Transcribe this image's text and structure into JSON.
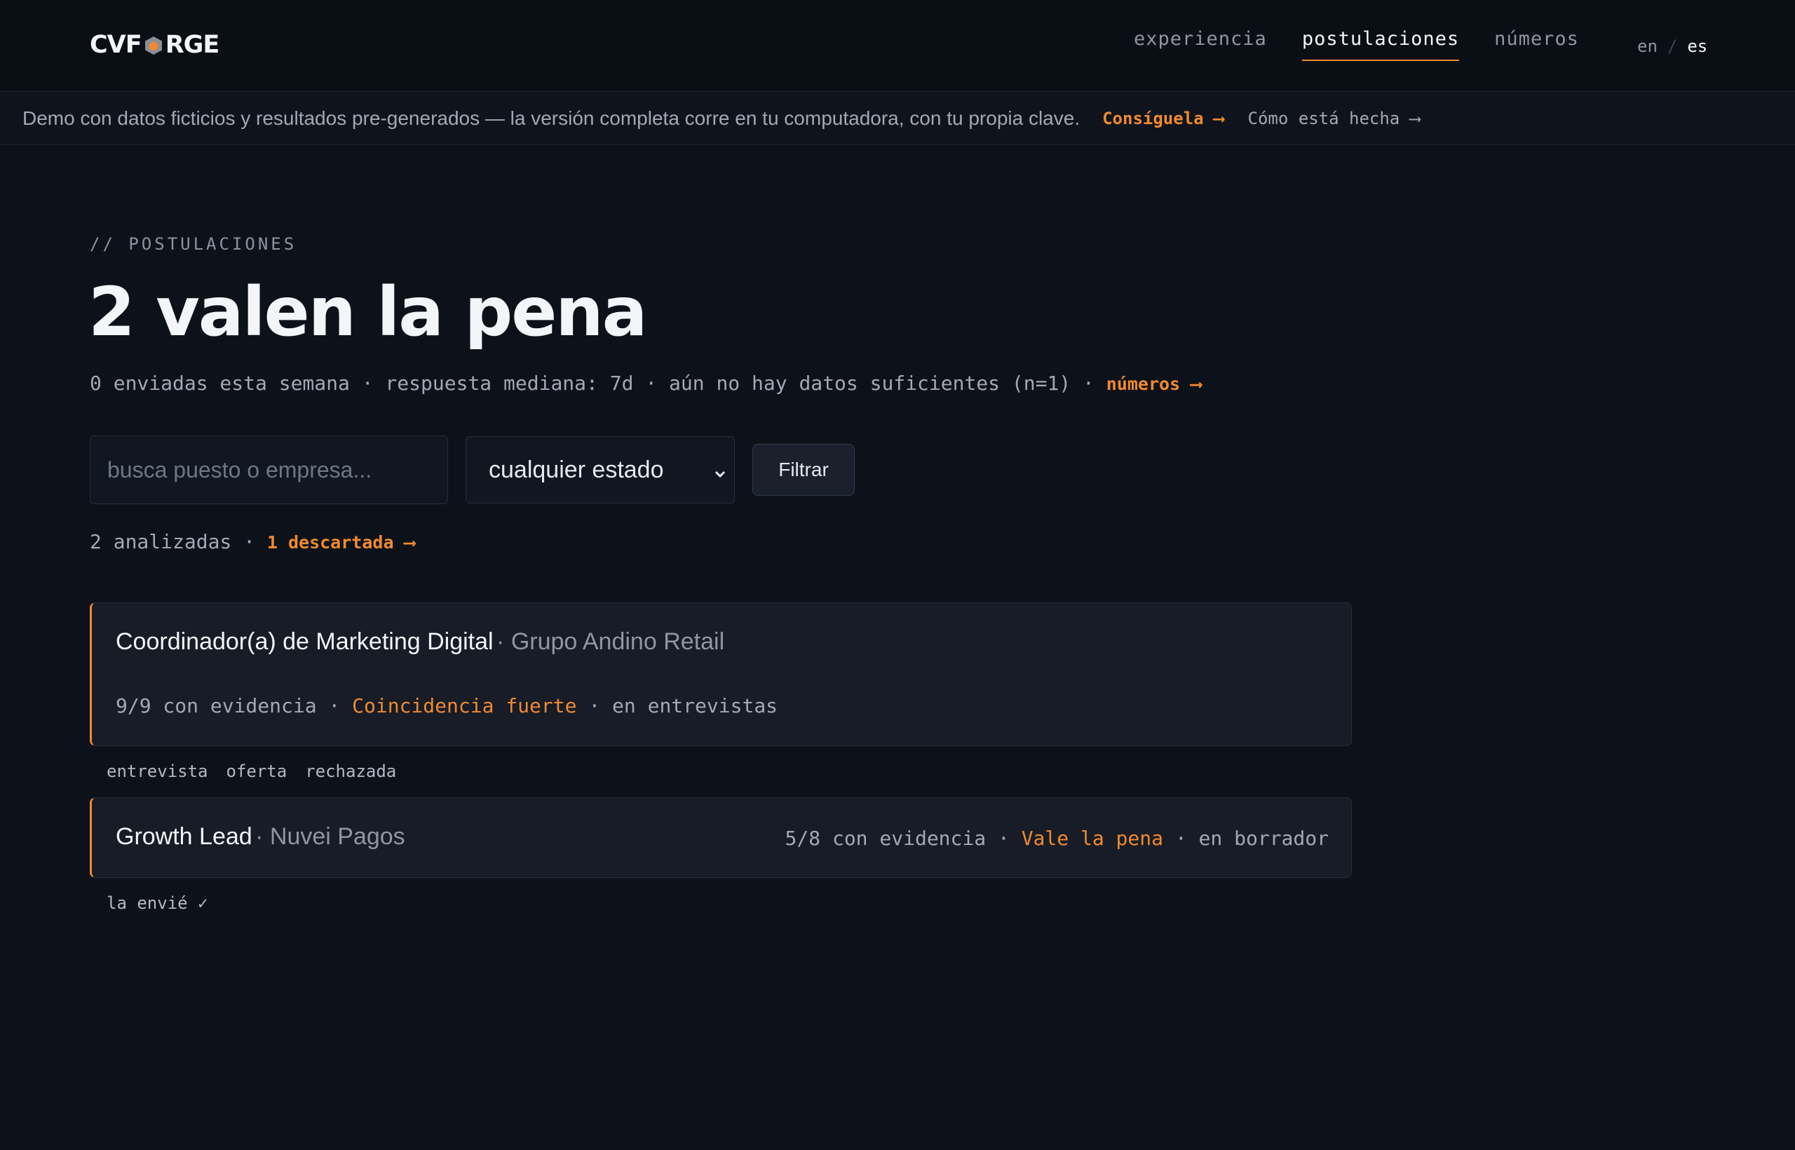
{
  "header": {
    "logo_left": "CVF",
    "logo_right": "RGE",
    "nav": [
      {
        "label": "experiencia",
        "active": false
      },
      {
        "label": "postulaciones",
        "active": true
      },
      {
        "label": "números",
        "active": false
      }
    ],
    "lang": {
      "en": "en",
      "sep": "/",
      "es": "es",
      "current": "es"
    }
  },
  "banner": {
    "message": "Demo con datos ficticios y resultados pre-generados — la versión completa corre en tu computadora, con tu propia clave.",
    "get_it": "Consíguela ⟶",
    "how_built": "Cómo está hecha ⟶"
  },
  "main": {
    "eyebrow": "// POSTULACIONES",
    "title": "2 valen la pena",
    "stats": "0 enviadas esta semana · respuesta mediana: 7d · aún no hay datos suficientes (n=1) ·",
    "stats_link": "números ⟶",
    "search_placeholder": "busca puesto o empresa...",
    "status_select": "cualquier estado",
    "filter_button": "Filtrar",
    "analyzed": "2 analizadas ·",
    "discarded_link": "1 descartada ⟶"
  },
  "applications": [
    {
      "role": "Coordinador(a) de Marketing Digital",
      "company": "· Grupo Andino Retail",
      "evidence": "9/9 con evidencia ·",
      "match": "Coincidencia fuerte",
      "status": "· en entrevistas",
      "actions": [
        "entrevista",
        "oferta",
        "rechazada"
      ]
    },
    {
      "role": "Growth Lead",
      "company": "· Nuvei Pagos",
      "evidence": "5/8 con evidencia ·",
      "match": "Vale la pena",
      "status": "· en borrador",
      "actions": [
        "la envié ✓"
      ]
    }
  ],
  "colors": {
    "accent": "#f08a30",
    "background": "#0d121a",
    "card": "#171c26"
  }
}
